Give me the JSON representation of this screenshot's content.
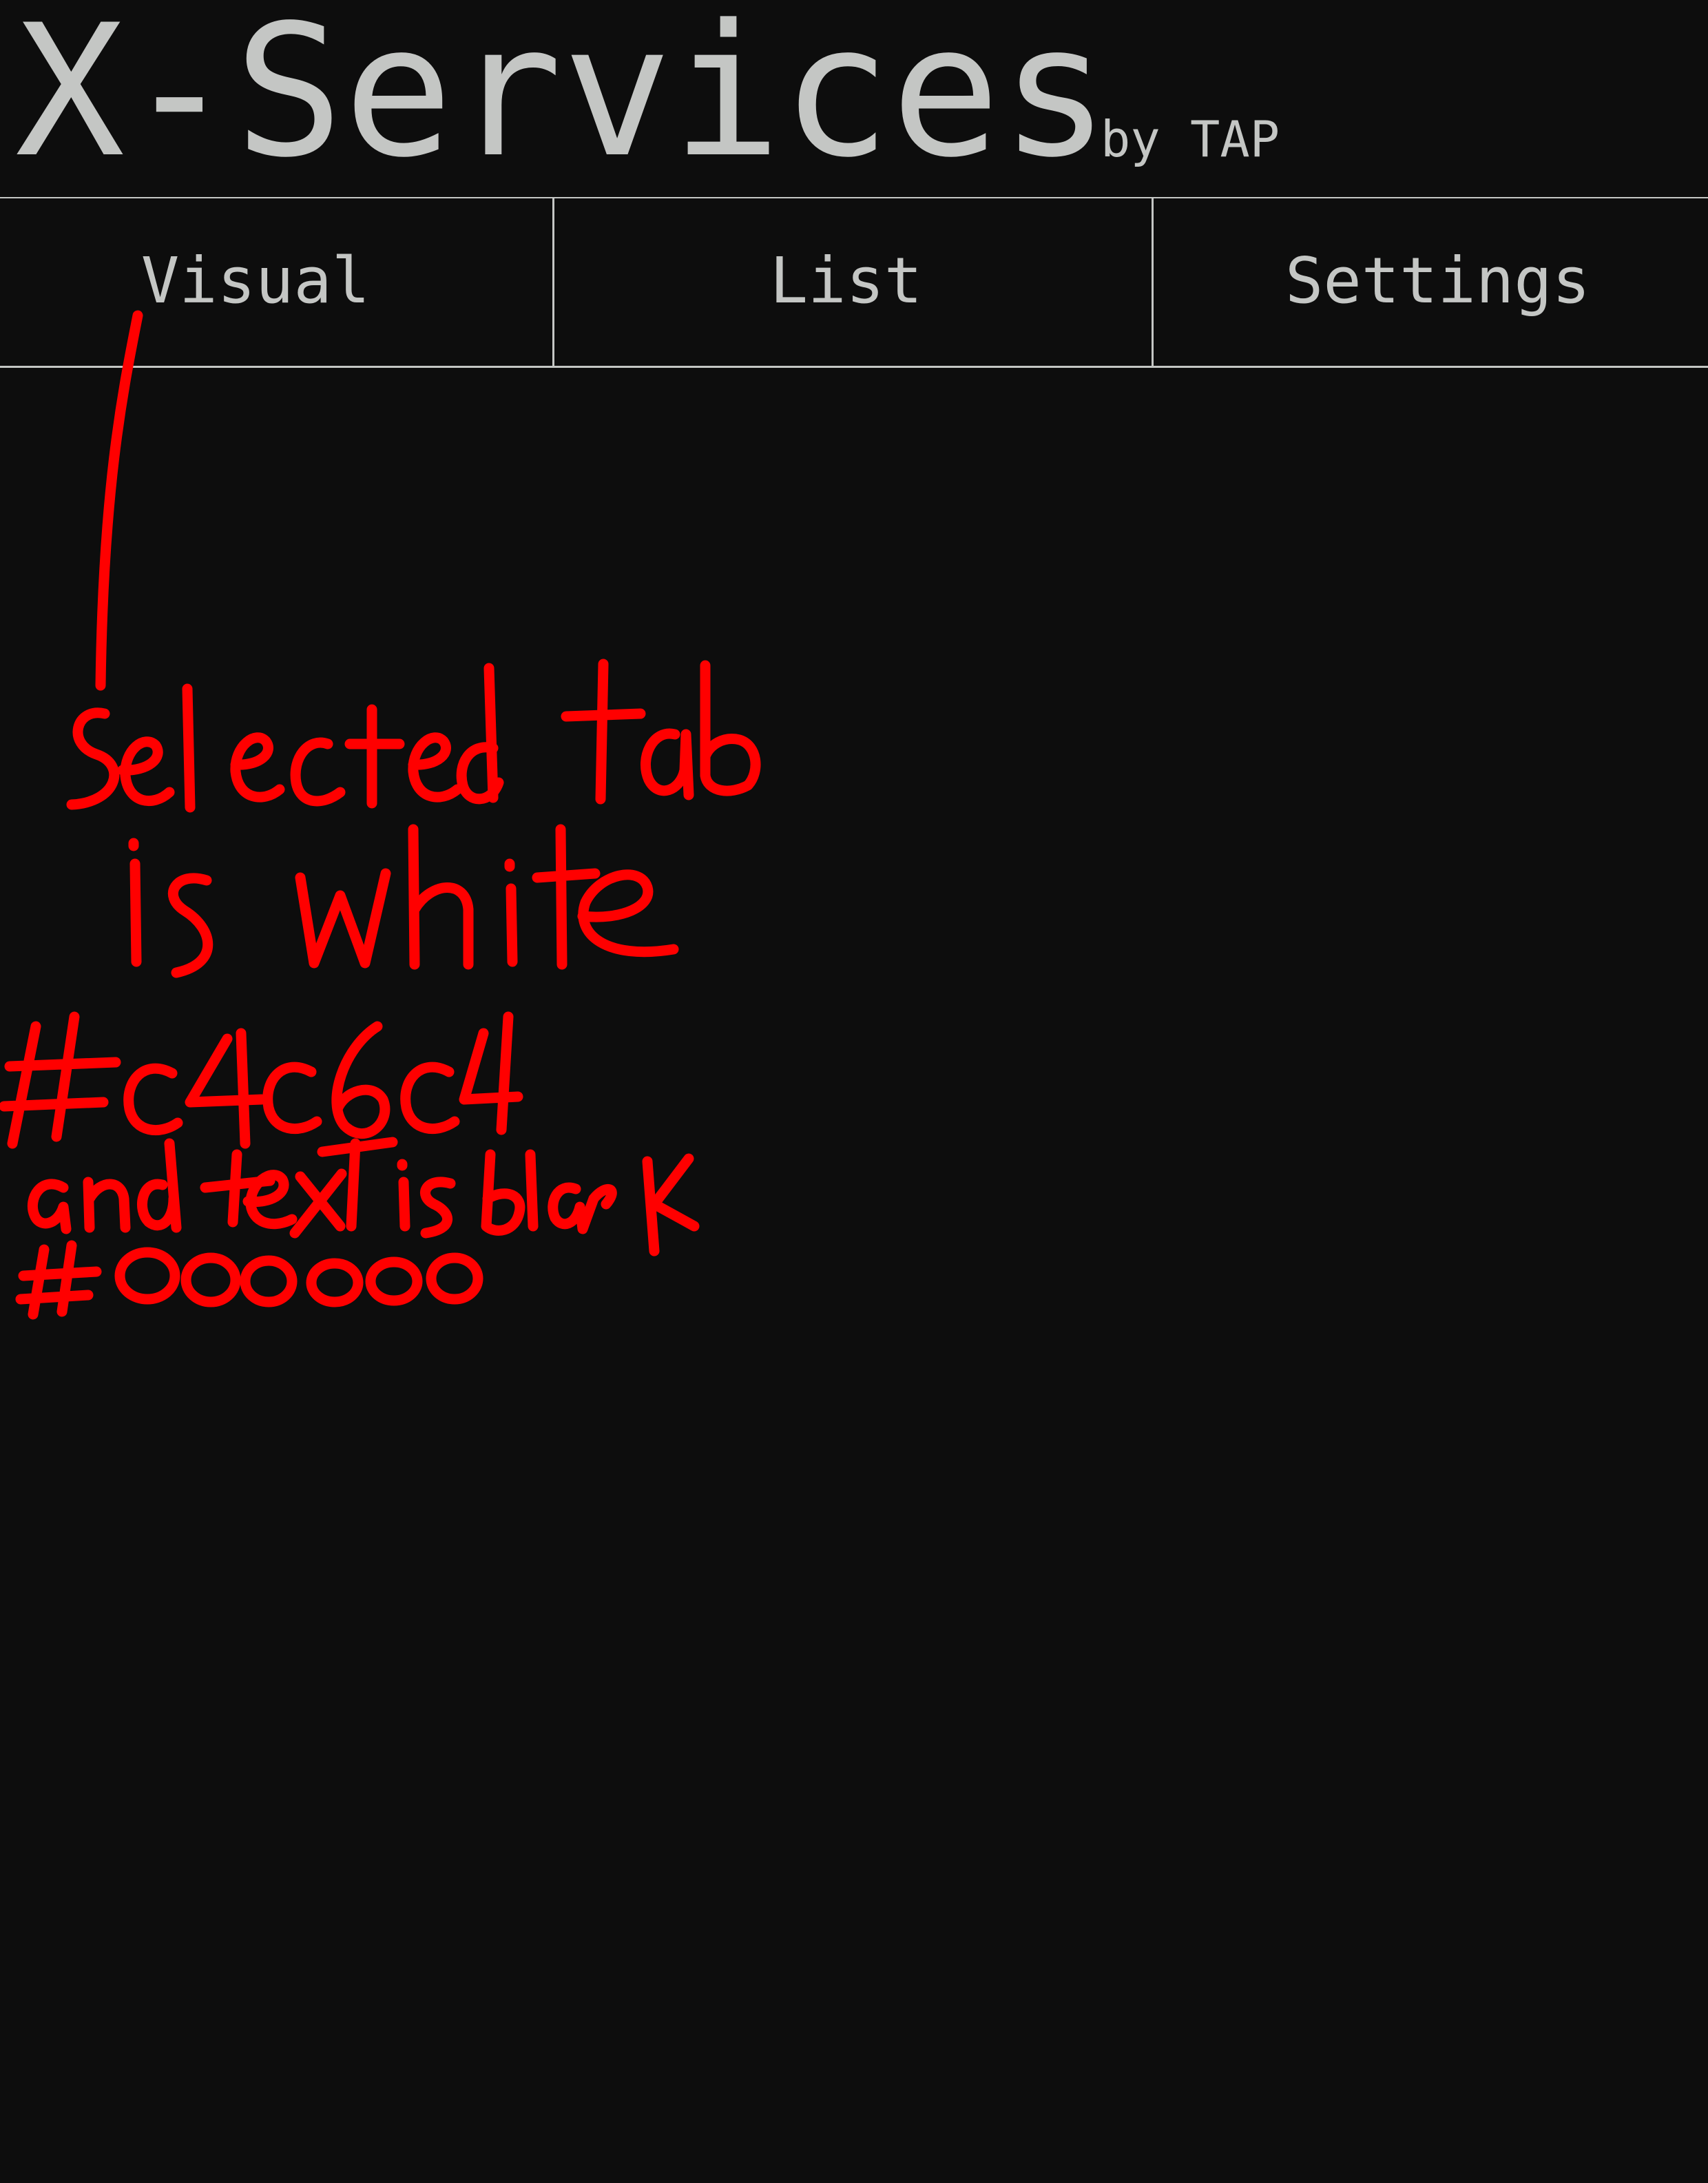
{
  "app": {
    "title": "X-Services",
    "subtitle": "by TAP"
  },
  "tabs": [
    {
      "label": "Visual"
    },
    {
      "label": "List"
    },
    {
      "label": "Settings"
    }
  ],
  "annotation": {
    "lines": [
      "Selected tab",
      "is white",
      "#c4c6c4",
      "and text is black",
      "#000000"
    ],
    "color": "#ff0000"
  },
  "colors": {
    "background": "#0d0d0d",
    "foreground": "#c4c6c4",
    "selected_tab_background": "#c4c6c4",
    "selected_tab_text": "#000000"
  }
}
